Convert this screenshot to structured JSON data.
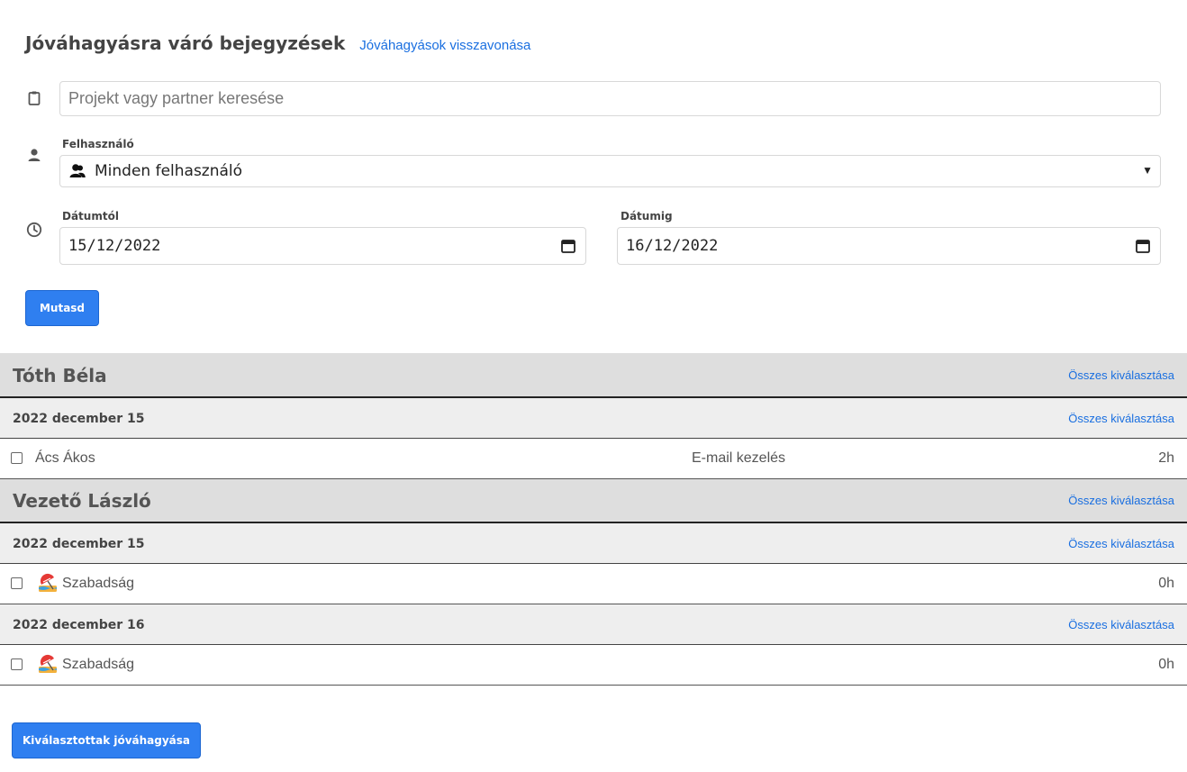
{
  "header": {
    "title": "Jóváhagyásra váró bejegyzések",
    "revoke_link": "Jóváhagyások visszavonása"
  },
  "filters": {
    "search_placeholder": "Projekt vagy partner keresése",
    "user_label": "Felhasználó",
    "user_value": "Minden  felhasználó",
    "date_from_label": "Dátumtól",
    "date_from_value": "15/12/2022",
    "date_to_label": "Dátumig",
    "date_to_value": "16/12/2022",
    "show_button": "Mutasd"
  },
  "select_all_label": "Összes kiválasztása",
  "groups": [
    {
      "user": "Tóth Béla",
      "days": [
        {
          "date": "2022 december 15",
          "entries": [
            {
              "name": "Ács Ákos",
              "task": "E-mail kezelés",
              "hours": "2h",
              "icon": ""
            }
          ]
        }
      ]
    },
    {
      "user": "Vezető László",
      "days": [
        {
          "date": "2022 december 15",
          "entries": [
            {
              "name": "Szabadság",
              "task": "",
              "hours": "0h",
              "icon": "beach-umbrella-icon"
            }
          ]
        },
        {
          "date": "2022 december 16",
          "entries": [
            {
              "name": "Szabadság",
              "task": "",
              "hours": "0h",
              "icon": "beach-umbrella-icon"
            }
          ]
        }
      ]
    }
  ],
  "approve_button": "Kiválasztottak jóváhagyása",
  "colors": {
    "primary": "#2f7ff0",
    "link": "#1a6fe0",
    "group_bg": "#dedede",
    "date_bg": "#eeeeee"
  }
}
